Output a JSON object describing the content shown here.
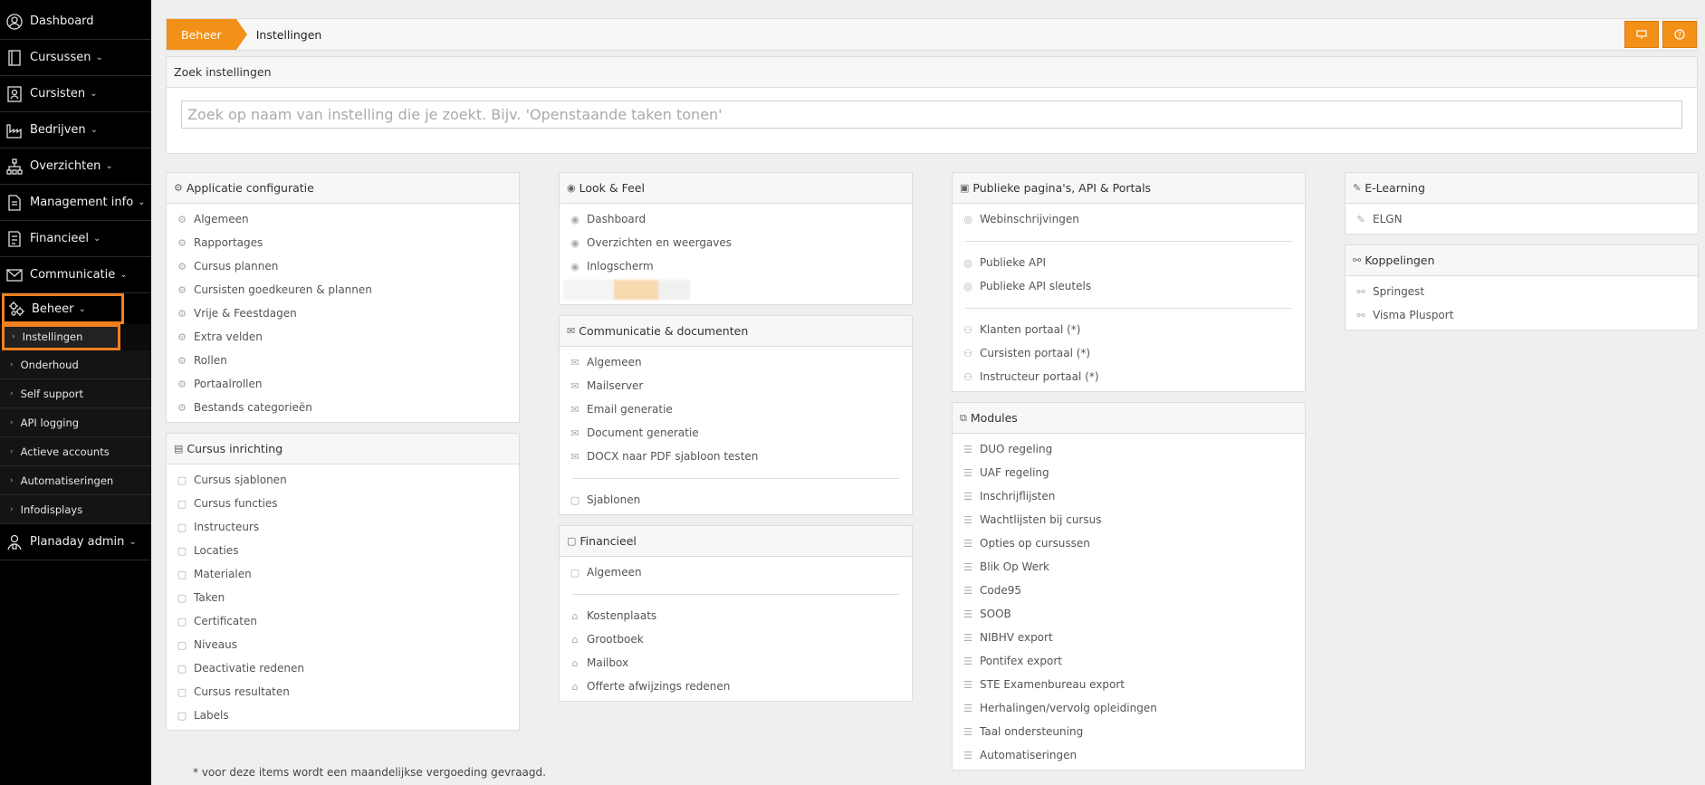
{
  "sidebar": {
    "items": [
      {
        "label": "Dashboard",
        "icon": "user-circle-icon",
        "chevron": false
      },
      {
        "label": "Cursussen",
        "icon": "book-icon",
        "chevron": true
      },
      {
        "label": "Cursisten",
        "icon": "contact-card-icon",
        "chevron": true
      },
      {
        "label": "Bedrijven",
        "icon": "factory-icon",
        "chevron": true
      },
      {
        "label": "Overzichten",
        "icon": "sitemap-icon",
        "chevron": true
      },
      {
        "label": "Management info",
        "icon": "document-icon",
        "chevron": true
      },
      {
        "label": "Financieel",
        "icon": "invoice-icon",
        "chevron": true
      },
      {
        "label": "Communicatie",
        "icon": "envelope-icon",
        "chevron": true
      },
      {
        "label": "Beheer",
        "icon": "cogs-icon",
        "chevron": true
      }
    ],
    "beheer_sub": [
      "Instellingen",
      "Onderhoud",
      "Self support",
      "API logging",
      "Actieve accounts",
      "Automatiseringen",
      "Infodisplays"
    ],
    "last_item": {
      "label": "Planaday admin",
      "icon": "admin-icon"
    }
  },
  "breadcrumb": {
    "home": "Beheer",
    "current": "Instellingen"
  },
  "search": {
    "title": "Zoek instellingen",
    "placeholder": "Zoek op naam van instelling die je zoekt. Bijv. 'Openstaande taken tonen'"
  },
  "panels": {
    "applicatie": {
      "title": "Applicatie configuratie",
      "items": [
        "Algemeen",
        "Rapportages",
        "Cursus plannen",
        "Cursisten goedkeuren & plannen",
        "Vrije & Feestdagen",
        "Extra velden",
        "Rollen",
        "Portaalrollen",
        "Bestands categorieën"
      ]
    },
    "cursus": {
      "title": "Cursus inrichting",
      "items": [
        "Cursus sjablonen",
        "Cursus functies",
        "Instructeurs",
        "Locaties",
        "Materialen",
        "Taken",
        "Certificaten",
        "Niveaus",
        "Deactivatie redenen",
        "Cursus resultaten",
        "Labels"
      ]
    },
    "look": {
      "title": "Look & Feel",
      "items": [
        "Dashboard",
        "Overzichten en weergaves",
        "Inlogscherm"
      ]
    },
    "communicatie": {
      "title": "Communicatie & documenten",
      "items": [
        "Algemeen",
        "Mailserver",
        "Email generatie",
        "Document generatie",
        "DOCX naar PDF sjabloon testen"
      ],
      "items2": [
        "Sjablonen"
      ]
    },
    "financieel": {
      "title": "Financieel",
      "items": [
        "Algemeen"
      ],
      "items2": [
        "Kostenplaats",
        "Grootboek",
        "Mailbox",
        "Offerte afwijzings redenen"
      ]
    },
    "publiek": {
      "title": "Publieke pagina's, API & Portals",
      "items": [
        "Webinschrijvingen"
      ],
      "items2": [
        "Publieke API",
        "Publieke API sleutels"
      ],
      "items3": [
        "Klanten portaal (*)",
        "Cursisten portaal (*)",
        "Instructeur portaal (*)"
      ]
    },
    "modules": {
      "title": "Modules",
      "items": [
        "DUO regeling",
        "UAF regeling",
        "Inschrijflijsten",
        "Wachtlijsten bij cursus",
        "Opties op cursussen",
        "Blik Op Werk",
        "Code95",
        "SOOB",
        "NIBHV export",
        "Pontifex export",
        "STE Examenbureau export",
        "Herhalingen/vervolg opleidingen",
        "Taal ondersteuning",
        "Automatiseringen"
      ]
    },
    "elearning": {
      "title": "E-Learning",
      "items": [
        "ELGN"
      ]
    },
    "koppelingen": {
      "title": "Koppelingen",
      "items": [
        "Springest",
        "Visma Plusport"
      ]
    }
  },
  "footnote": "* voor deze items wordt een maandelijkse vergoeding gevraagd.",
  "colors": {
    "accent": "#f39018",
    "sidebar": "#000000",
    "highlight": "#f08020"
  }
}
